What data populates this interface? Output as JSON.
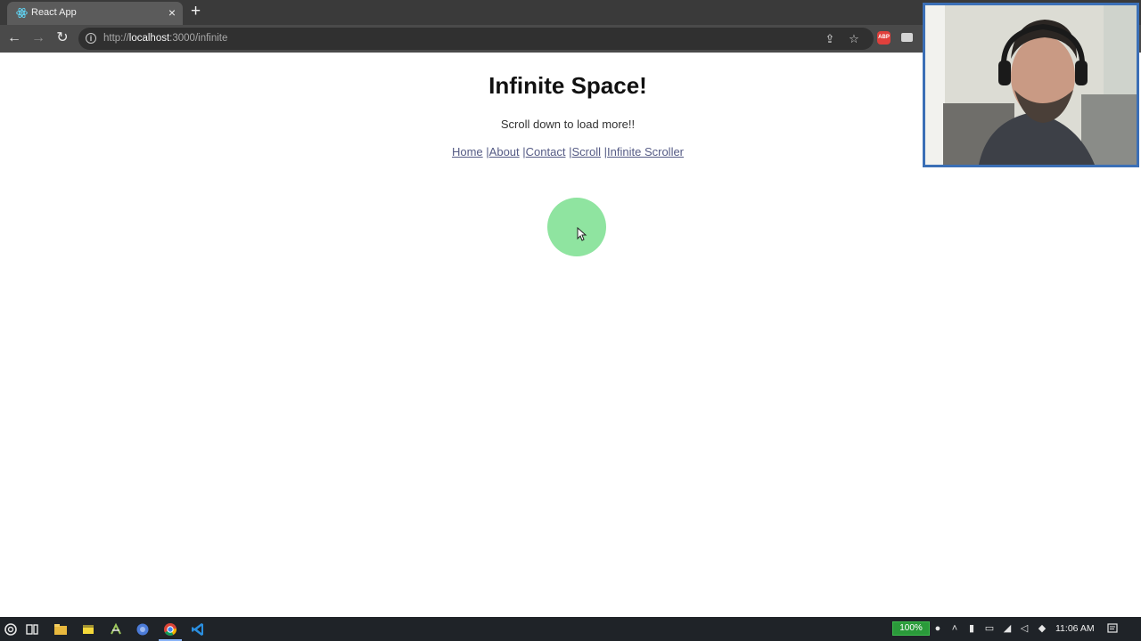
{
  "browser": {
    "tab": {
      "title": "React App",
      "close_glyph": "×",
      "favicon": "react-icon"
    },
    "new_tab_glyph": "+",
    "toolbar": {
      "back_glyph": "←",
      "forward_glyph": "→",
      "reload_glyph": "↻",
      "url_prefix": "http://",
      "url_host": "localhost",
      "url_path": ":3000/infinite",
      "share_glyph": "⇪",
      "bookmark_glyph": "☆",
      "adblock_label": "ABP"
    }
  },
  "page": {
    "title": "Infinite Space!",
    "subtitle": "Scroll down to load more!!",
    "nav": [
      {
        "label": "Home",
        "prefix": ""
      },
      {
        "label": "About",
        "prefix": "|"
      },
      {
        "label": "Contact",
        "prefix": "|"
      },
      {
        "label": "Scroll",
        "prefix": "|"
      },
      {
        "label": "Infinite Scroller",
        "prefix": "|"
      }
    ],
    "loader_color": "#8fe4a0"
  },
  "taskbar": {
    "battery": "100%",
    "clock": "11:06 AM"
  }
}
